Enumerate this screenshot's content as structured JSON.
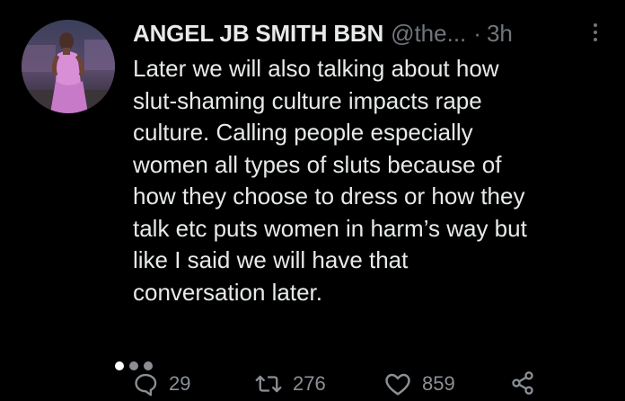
{
  "tweet": {
    "display_name": "ANGEL JB SMITH BBN",
    "handle": "@the...",
    "separator": "·",
    "timestamp": "3h",
    "text_lines": [
      "Later we will also talking about how",
      "slut-shaming culture impacts rape",
      "culture. Calling people especially",
      "women all types of sluts because of",
      "how they choose to dress or how they",
      "talk etc puts women in harm’s way but",
      "like I said we will have that",
      "conversation later."
    ],
    "actions": {
      "reply_count": "29",
      "retweet_count": "276",
      "like_count": "859"
    }
  },
  "icons": {
    "avatar": "profile-photo",
    "more": "more-vertical-icon",
    "reply": "reply-icon",
    "retweet": "retweet-icon",
    "like": "heart-icon",
    "share": "share-icon"
  },
  "colors": {
    "background": "#000000",
    "primary_text": "#e7e9ea",
    "secondary_text": "#71767b",
    "action_icon": "#8b9096"
  }
}
